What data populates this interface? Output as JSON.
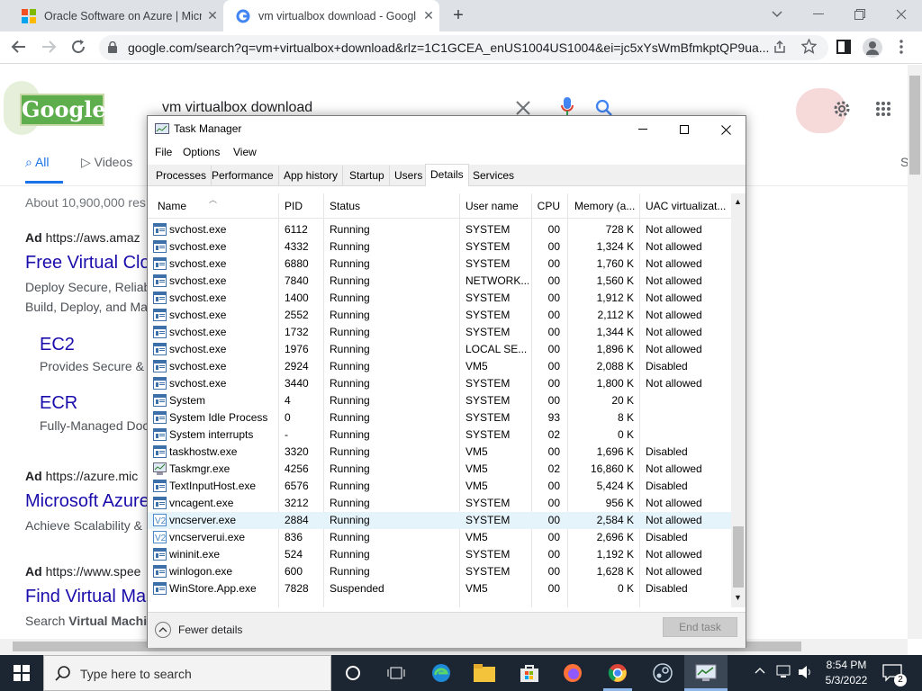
{
  "browser": {
    "tabs": [
      {
        "title": "Oracle Software on Azure | Micro"
      },
      {
        "title": "vm virtualbox download - Googl"
      }
    ],
    "url": "google.com/search?q=vm+virtualbox+download&rlz=1C1GCEA_enUS1004US1004&ei=jc5xYsWmBfmkptQP9ua..."
  },
  "google": {
    "logo": "Google",
    "query": "vm virtualbox download",
    "nav": [
      {
        "label": "All"
      },
      {
        "label": "Videos"
      }
    ],
    "nav_right": "S",
    "stats": "About 10,900,000 res",
    "results": [
      {
        "ad": "Ad",
        "url": "https://aws.amaz",
        "title": "Free Virtual Clo",
        "desc1": "Deploy Secure, Reliab",
        "desc2": "Build, Deploy, and Ma"
      },
      {
        "sub_title": "EC2",
        "sub_desc": "Provides Secure &"
      },
      {
        "sub_title": "ECR",
        "sub_desc": "Fully-Managed Doc"
      },
      {
        "ad": "Ad",
        "url": "https://azure.mic",
        "title": "Microsoft Azure",
        "desc1": "Achieve Scalability &"
      },
      {
        "ad": "Ad",
        "url": "https://www.spee",
        "title": "Find Virtual Ma",
        "desc1_bold": "Virtual Machi",
        "desc1_prefix": "Search "
      }
    ]
  },
  "taskmanager": {
    "title": "Task Manager",
    "menu": [
      "File",
      "Options",
      "View"
    ],
    "tabs": [
      "Processes",
      "Performance",
      "App history",
      "Startup",
      "Users",
      "Details",
      "Services"
    ],
    "active_tab": "Details",
    "columns": [
      "Name",
      "PID",
      "Status",
      "User name",
      "CPU",
      "Memory (a...",
      "UAC virtualizat..."
    ],
    "rows": [
      {
        "name": "svchost.exe",
        "pid": "6112",
        "status": "Running",
        "user": "SYSTEM",
        "cpu": "00",
        "mem": "728 K",
        "uac": "Not allowed"
      },
      {
        "name": "svchost.exe",
        "pid": "4332",
        "status": "Running",
        "user": "SYSTEM",
        "cpu": "00",
        "mem": "1,324 K",
        "uac": "Not allowed"
      },
      {
        "name": "svchost.exe",
        "pid": "6880",
        "status": "Running",
        "user": "SYSTEM",
        "cpu": "00",
        "mem": "1,760 K",
        "uac": "Not allowed"
      },
      {
        "name": "svchost.exe",
        "pid": "7840",
        "status": "Running",
        "user": "NETWORK...",
        "cpu": "00",
        "mem": "1,560 K",
        "uac": "Not allowed"
      },
      {
        "name": "svchost.exe",
        "pid": "1400",
        "status": "Running",
        "user": "SYSTEM",
        "cpu": "00",
        "mem": "1,912 K",
        "uac": "Not allowed"
      },
      {
        "name": "svchost.exe",
        "pid": "2552",
        "status": "Running",
        "user": "SYSTEM",
        "cpu": "00",
        "mem": "2,112 K",
        "uac": "Not allowed"
      },
      {
        "name": "svchost.exe",
        "pid": "1732",
        "status": "Running",
        "user": "SYSTEM",
        "cpu": "00",
        "mem": "1,344 K",
        "uac": "Not allowed"
      },
      {
        "name": "svchost.exe",
        "pid": "1976",
        "status": "Running",
        "user": "LOCAL SE...",
        "cpu": "00",
        "mem": "1,896 K",
        "uac": "Not allowed"
      },
      {
        "name": "svchost.exe",
        "pid": "2924",
        "status": "Running",
        "user": "VM5",
        "cpu": "00",
        "mem": "2,088 K",
        "uac": "Disabled"
      },
      {
        "name": "svchost.exe",
        "pid": "3440",
        "status": "Running",
        "user": "SYSTEM",
        "cpu": "00",
        "mem": "1,800 K",
        "uac": "Not allowed"
      },
      {
        "name": "System",
        "pid": "4",
        "status": "Running",
        "user": "SYSTEM",
        "cpu": "00",
        "mem": "20 K",
        "uac": ""
      },
      {
        "name": "System Idle Process",
        "pid": "0",
        "status": "Running",
        "user": "SYSTEM",
        "cpu": "93",
        "mem": "8 K",
        "uac": ""
      },
      {
        "name": "System interrupts",
        "pid": "-",
        "status": "Running",
        "user": "SYSTEM",
        "cpu": "02",
        "mem": "0 K",
        "uac": ""
      },
      {
        "name": "taskhostw.exe",
        "pid": "3320",
        "status": "Running",
        "user": "VM5",
        "cpu": "00",
        "mem": "1,696 K",
        "uac": "Disabled"
      },
      {
        "name": "Taskmgr.exe",
        "pid": "4256",
        "status": "Running",
        "user": "VM5",
        "cpu": "02",
        "mem": "16,860 K",
        "uac": "Not allowed"
      },
      {
        "name": "TextInputHost.exe",
        "pid": "6576",
        "status": "Running",
        "user": "VM5",
        "cpu": "00",
        "mem": "5,424 K",
        "uac": "Disabled"
      },
      {
        "name": "vncagent.exe",
        "pid": "3212",
        "status": "Running",
        "user": "SYSTEM",
        "cpu": "00",
        "mem": "956 K",
        "uac": "Not allowed"
      },
      {
        "name": "vncserver.exe",
        "pid": "2884",
        "status": "Running",
        "user": "SYSTEM",
        "cpu": "00",
        "mem": "2,584 K",
        "uac": "Not allowed",
        "selected": true
      },
      {
        "name": "vncserverui.exe",
        "pid": "836",
        "status": "Running",
        "user": "VM5",
        "cpu": "00",
        "mem": "2,696 K",
        "uac": "Disabled"
      },
      {
        "name": "wininit.exe",
        "pid": "524",
        "status": "Running",
        "user": "SYSTEM",
        "cpu": "00",
        "mem": "1,192 K",
        "uac": "Not allowed"
      },
      {
        "name": "winlogon.exe",
        "pid": "600",
        "status": "Running",
        "user": "SYSTEM",
        "cpu": "00",
        "mem": "1,628 K",
        "uac": "Not allowed"
      },
      {
        "name": "WinStore.App.exe",
        "pid": "7828",
        "status": "Suspended",
        "user": "VM5",
        "cpu": "00",
        "mem": "0 K",
        "uac": "Disabled"
      }
    ],
    "fewer_details": "Fewer details",
    "end_task": "End task"
  },
  "taskbar": {
    "search_placeholder": "Type here to search",
    "time": "8:54 PM",
    "date": "5/3/2022",
    "notif_count": "2"
  }
}
